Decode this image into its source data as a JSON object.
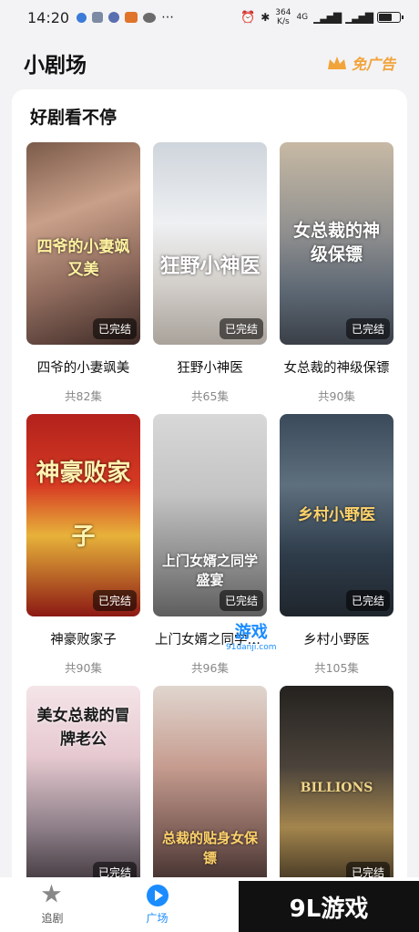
{
  "status_bar": {
    "time": "14:20",
    "net_speed_value": "364",
    "net_speed_unit": "K/s",
    "signal_label": "4G"
  },
  "header": {
    "title": "小剧场",
    "no_ads_label": "免广告"
  },
  "section": {
    "title": "好剧看不停"
  },
  "dramas": [
    {
      "title": "四爷的小妻飒美",
      "count": "共82集",
      "badge": "已完结",
      "poster_text": "四爷的小妻飒又美"
    },
    {
      "title": "狂野小神医",
      "count": "共65集",
      "badge": "已完结",
      "poster_text": "狂野小神医"
    },
    {
      "title": "女总裁的神级保镖",
      "count": "共90集",
      "badge": "已完结",
      "poster_text": "女总裁的神级保镖"
    },
    {
      "title": "神豪败家子",
      "count": "共90集",
      "badge": "已完结",
      "poster_text": "神豪败家子"
    },
    {
      "title": "上门女婿之同学盛宴",
      "count": "共96集",
      "badge": "已完结",
      "poster_text": "上门女婿之同学盛宴"
    },
    {
      "title": "乡村小野医",
      "count": "共105集",
      "badge": "已完结",
      "poster_text": "乡村小野医"
    },
    {
      "title": "",
      "count": "",
      "badge": "已完结",
      "poster_text": "美女总裁的冒牌老公"
    },
    {
      "title": "",
      "count": "",
      "badge": "已完结",
      "poster_text": "总裁的贴身女保镖"
    },
    {
      "title": "",
      "count": "",
      "badge": "已完结",
      "poster_text": "BILLIONS"
    }
  ],
  "bottom_nav": {
    "items": [
      {
        "label": "追剧",
        "icon": "star-icon",
        "active": false
      },
      {
        "label": "广场",
        "icon": "play-icon",
        "active": true
      }
    ]
  },
  "watermark": {
    "logo_text": "9L游戏",
    "mid_text": "游戏",
    "mid_sub": "91danji.com"
  },
  "colors": {
    "accent": "#1a8cff",
    "no_ads": "#f2a33a",
    "background": "#f3f3f5"
  }
}
